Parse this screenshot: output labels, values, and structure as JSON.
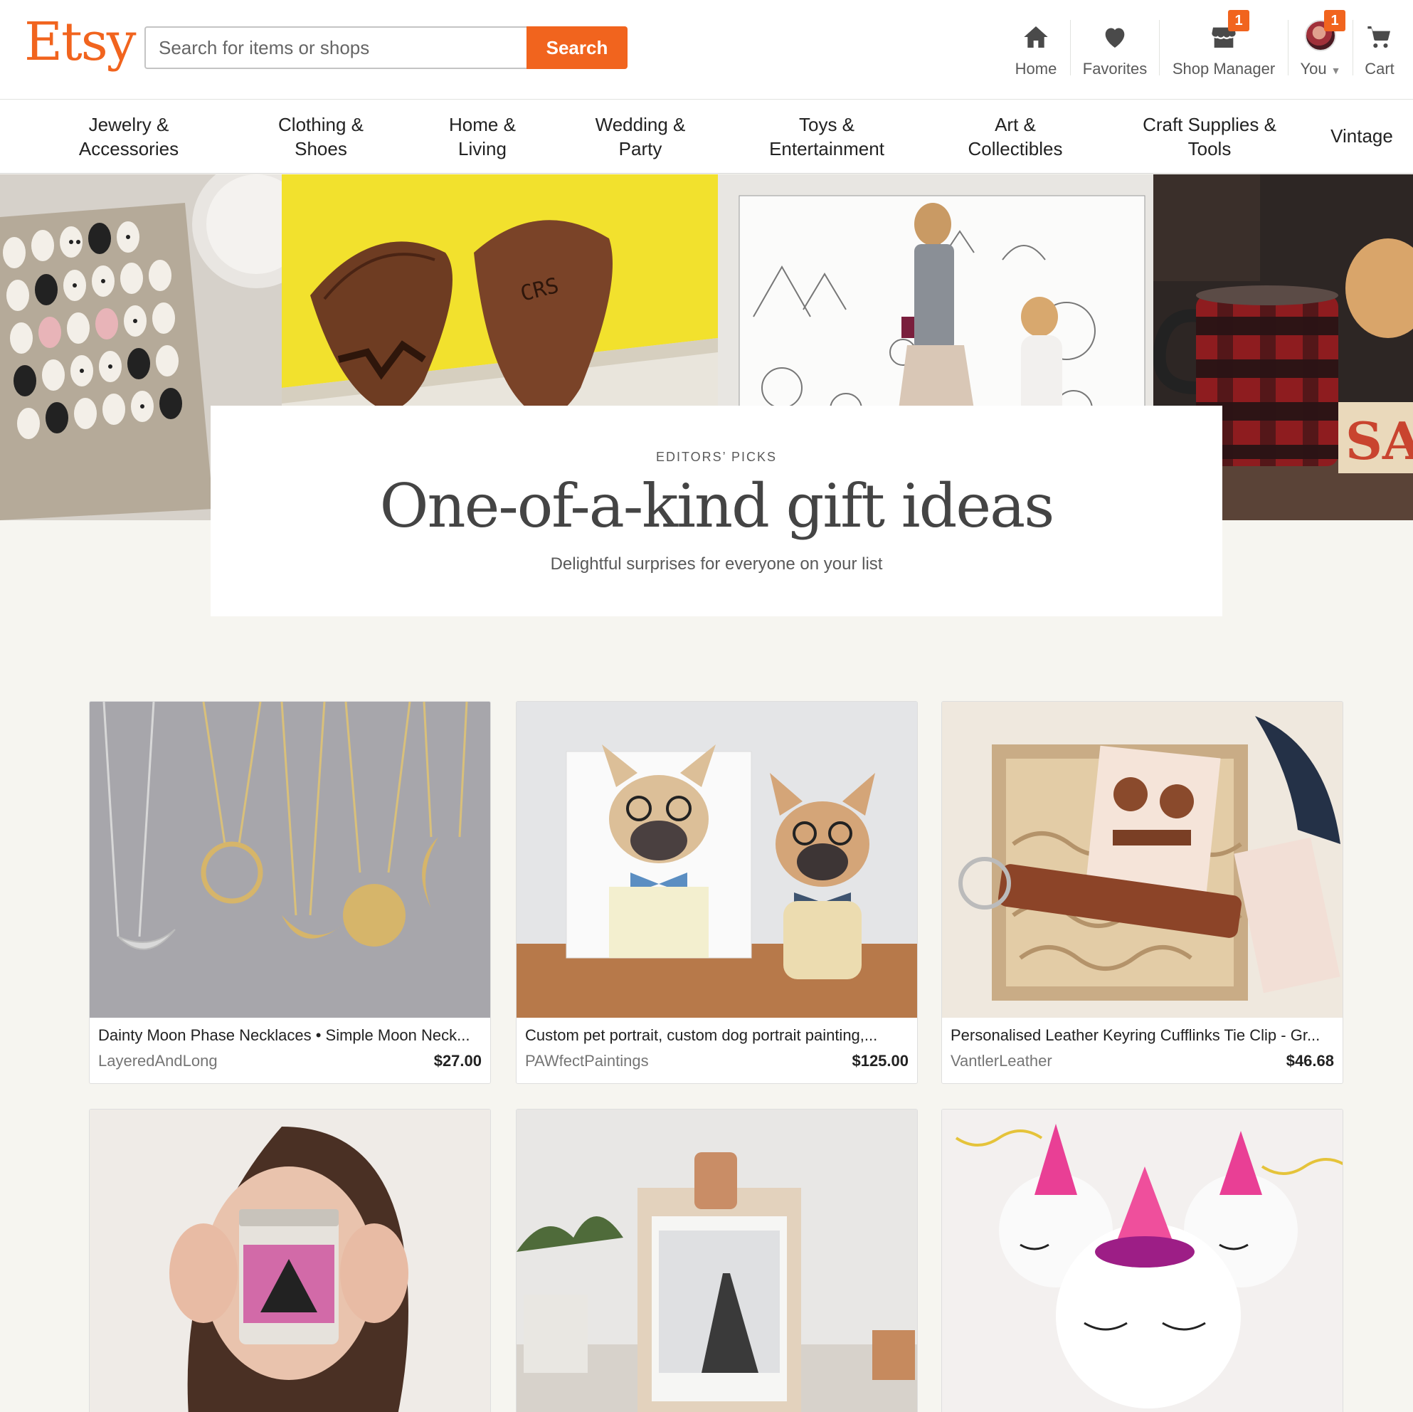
{
  "header": {
    "logo": "Etsy",
    "search_placeholder": "Search for items or shops",
    "search_button": "Search",
    "nav": [
      {
        "label": "Home",
        "icon": "home-icon"
      },
      {
        "label": "Favorites",
        "icon": "heart-icon"
      },
      {
        "label": "Shop Manager",
        "icon": "shop-icon",
        "badge": "1"
      },
      {
        "label": "You",
        "icon": "avatar",
        "badge": "1"
      },
      {
        "label": "Cart",
        "icon": "cart-icon"
      }
    ]
  },
  "categories": [
    [
      "Jewelry &",
      "Accessories"
    ],
    [
      "Clothing &",
      "Shoes"
    ],
    [
      "Home &",
      "Living"
    ],
    [
      "Wedding &",
      "Party"
    ],
    [
      "Toys &",
      "Entertainment"
    ],
    [
      "Art &",
      "Collectibles"
    ],
    [
      "Craft Supplies &",
      "Tools"
    ],
    [
      "Vintage"
    ]
  ],
  "hero": {
    "eyebrow": "EDITORS’ PICKS",
    "title": "One-of-a-kind gift ideas",
    "subtitle": "Delightful surprises for everyone on your list",
    "pick_engraving": "CRS",
    "sign_text": "SA"
  },
  "listings": [
    {
      "title": "Dainty Moon Phase Necklaces • Simple Moon Neck...",
      "shop": "LayeredAndLong",
      "price": "$27.00"
    },
    {
      "title": "Custom pet portrait, custom dog portrait painting,...",
      "shop": "PAWfectPaintings",
      "price": "$125.00"
    },
    {
      "title": "Personalised Leather Keyring Cufflinks Tie Clip - Gr...",
      "shop": "VantlerLeather",
      "price": "$46.68"
    },
    {
      "title": "",
      "shop": "",
      "price": ""
    },
    {
      "title": "",
      "shop": "",
      "price": ""
    },
    {
      "title": "",
      "shop": "",
      "price": ""
    }
  ],
  "colors": {
    "brand": "#f1641e",
    "background": "#f6f5f0"
  }
}
